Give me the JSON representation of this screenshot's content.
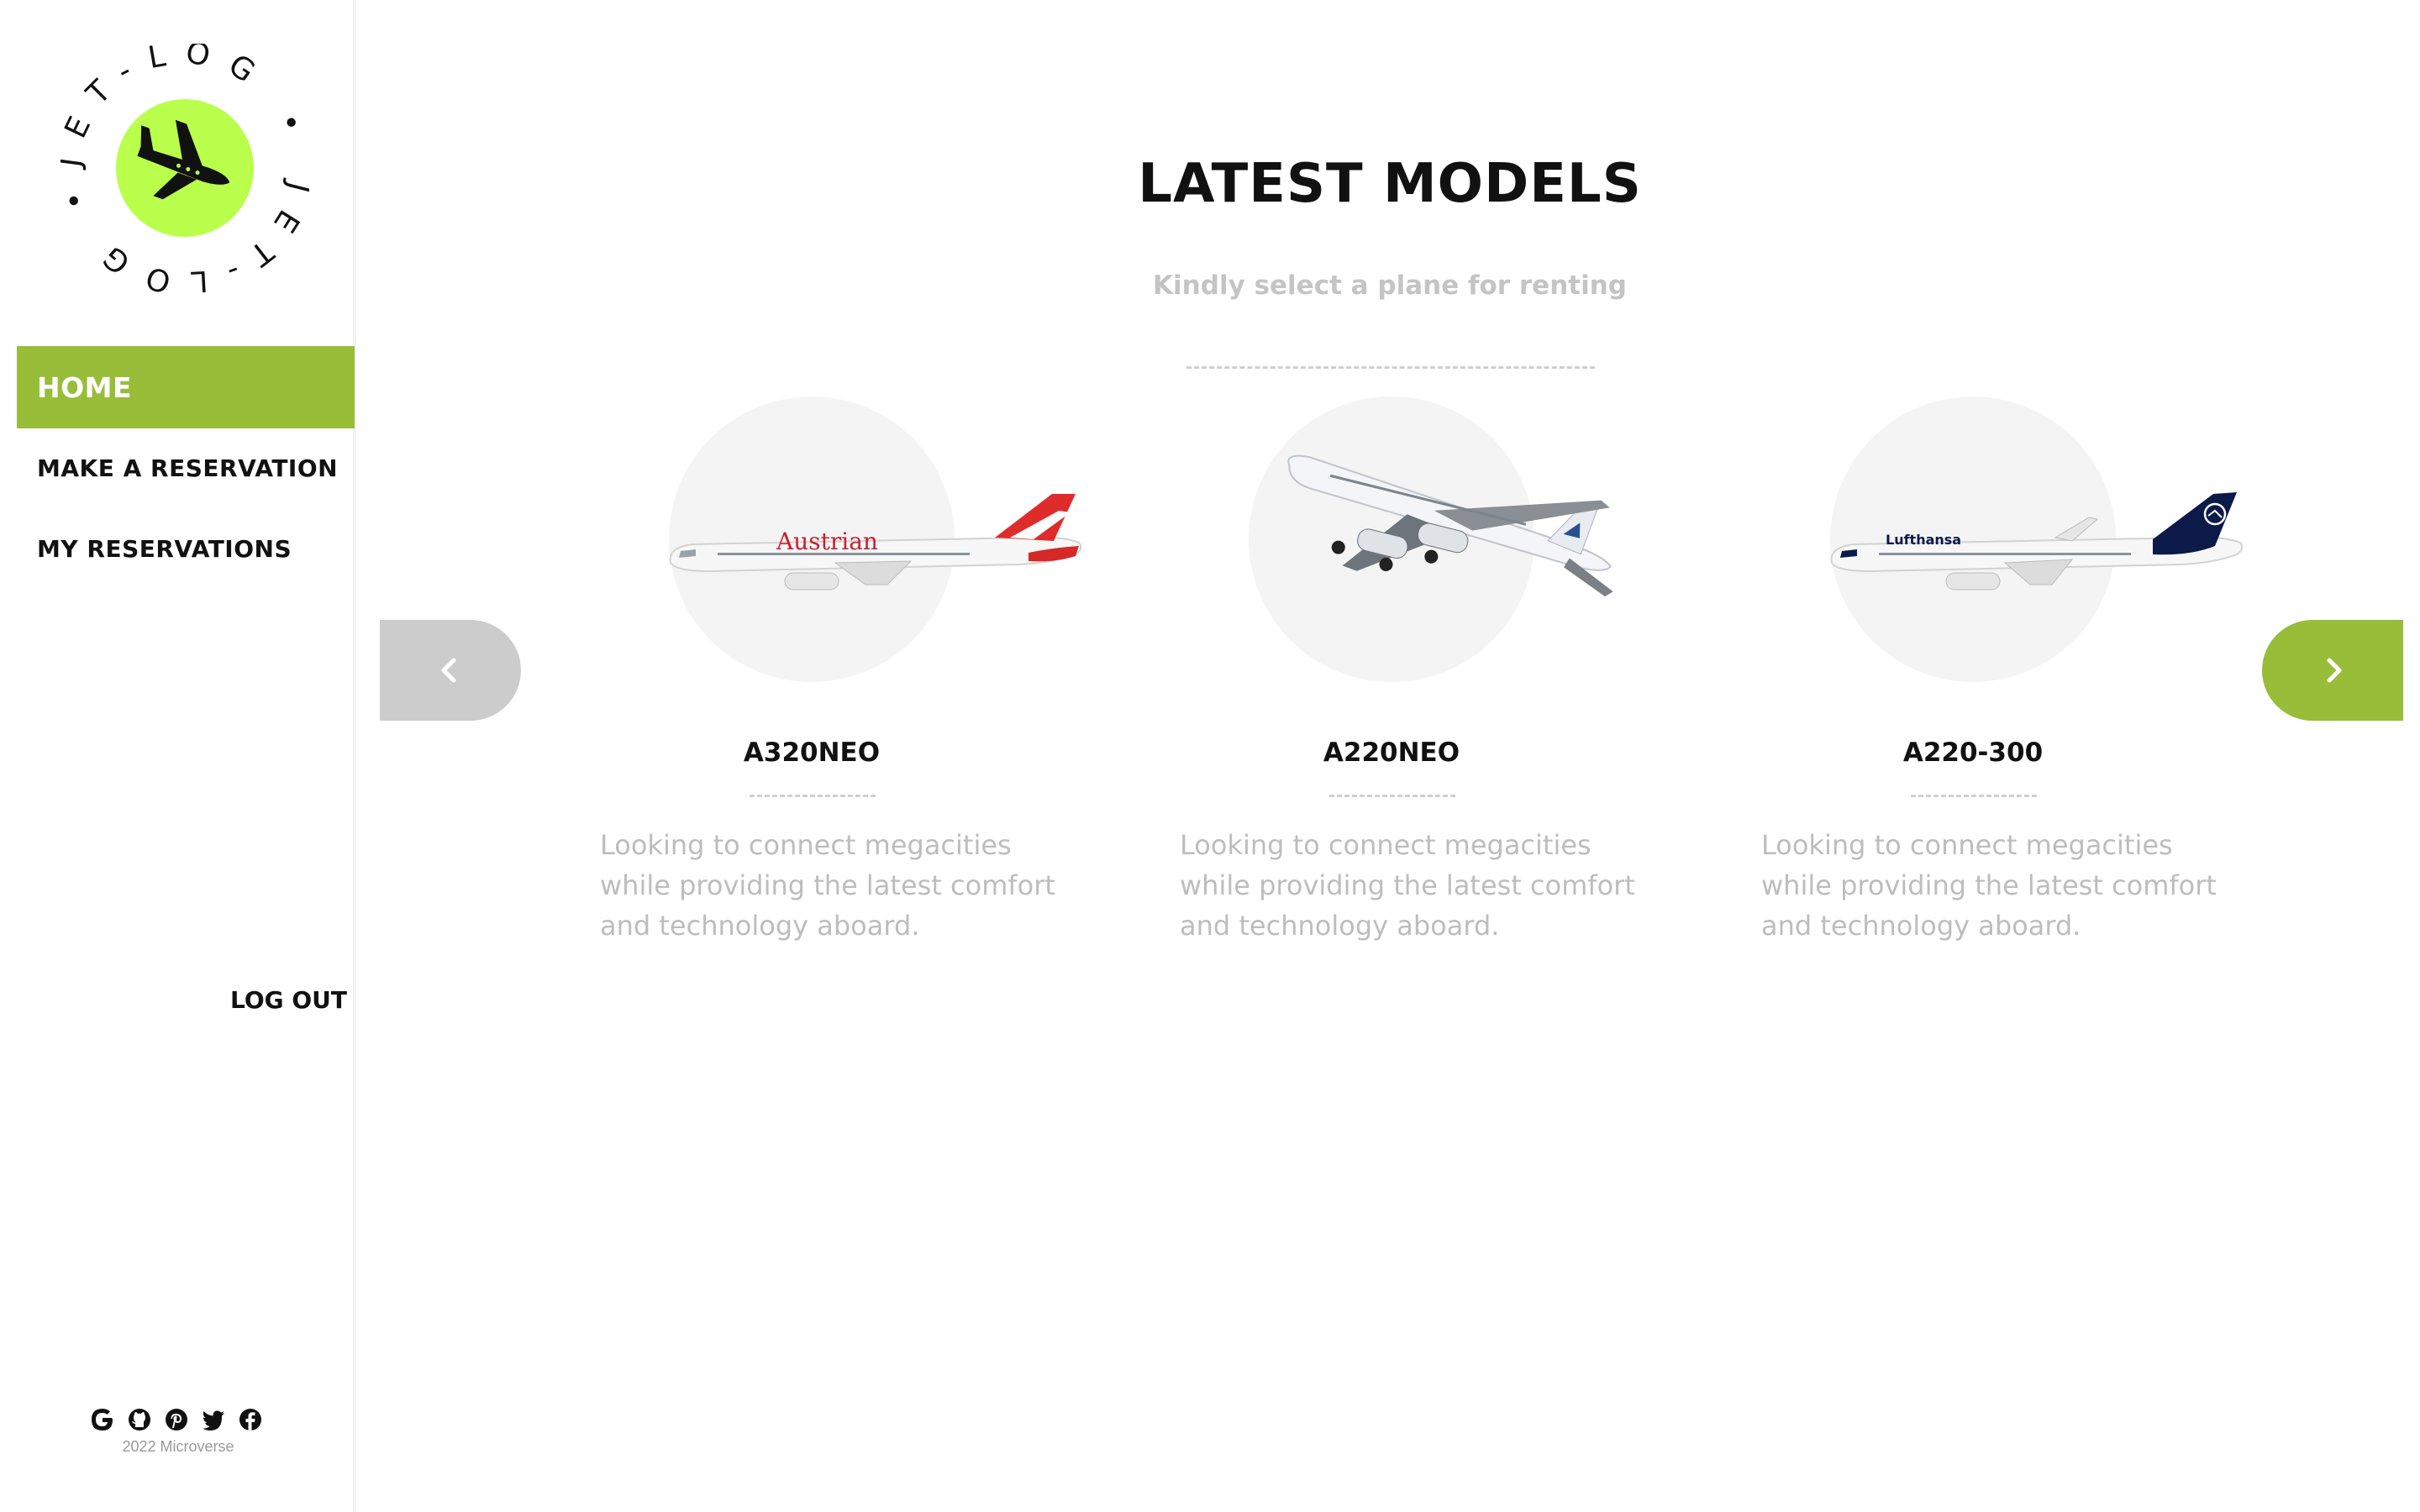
{
  "sidebar": {
    "logo": {
      "ring_text": "JET-LOG • JET-LOG •",
      "icon": "airplane-takeoff-icon",
      "accent": "#b9ff4b"
    },
    "nav": [
      {
        "label": "HOME",
        "active": true
      },
      {
        "label": "MAKE A RESERVATION",
        "active": false
      },
      {
        "label": "MY RESERVATIONS",
        "active": false
      }
    ],
    "logout_label": "LOG OUT",
    "social_icons": [
      "google-icon",
      "github-icon",
      "pinterest-icon",
      "twitter-icon",
      "facebook-icon"
    ],
    "copyright": "2022 Microverse"
  },
  "main": {
    "title": "LATEST MODELS",
    "subtitle": "Kindly select a plane for renting",
    "carousel": {
      "prev_icon": "chevron-left-icon",
      "next_icon": "chevron-right-icon",
      "items": [
        {
          "name": "A320NEO",
          "description": "Looking to connect megacities while providing the latest comfort and technology aboard.",
          "airline": "Austrian"
        },
        {
          "name": "A220NEO",
          "description": "Looking to connect megacities while providing the latest comfort and technology aboard.",
          "airline": ""
        },
        {
          "name": "A220-300",
          "description": "Looking to connect megacities while providing the latest comfort and technology aboard.",
          "airline": "Lufthansa"
        }
      ]
    }
  },
  "colors": {
    "accent_green": "#98bd38",
    "logo_green": "#b9ff4b",
    "muted_text": "#bdbdbd",
    "disabled_arrow": "#cccccc"
  }
}
